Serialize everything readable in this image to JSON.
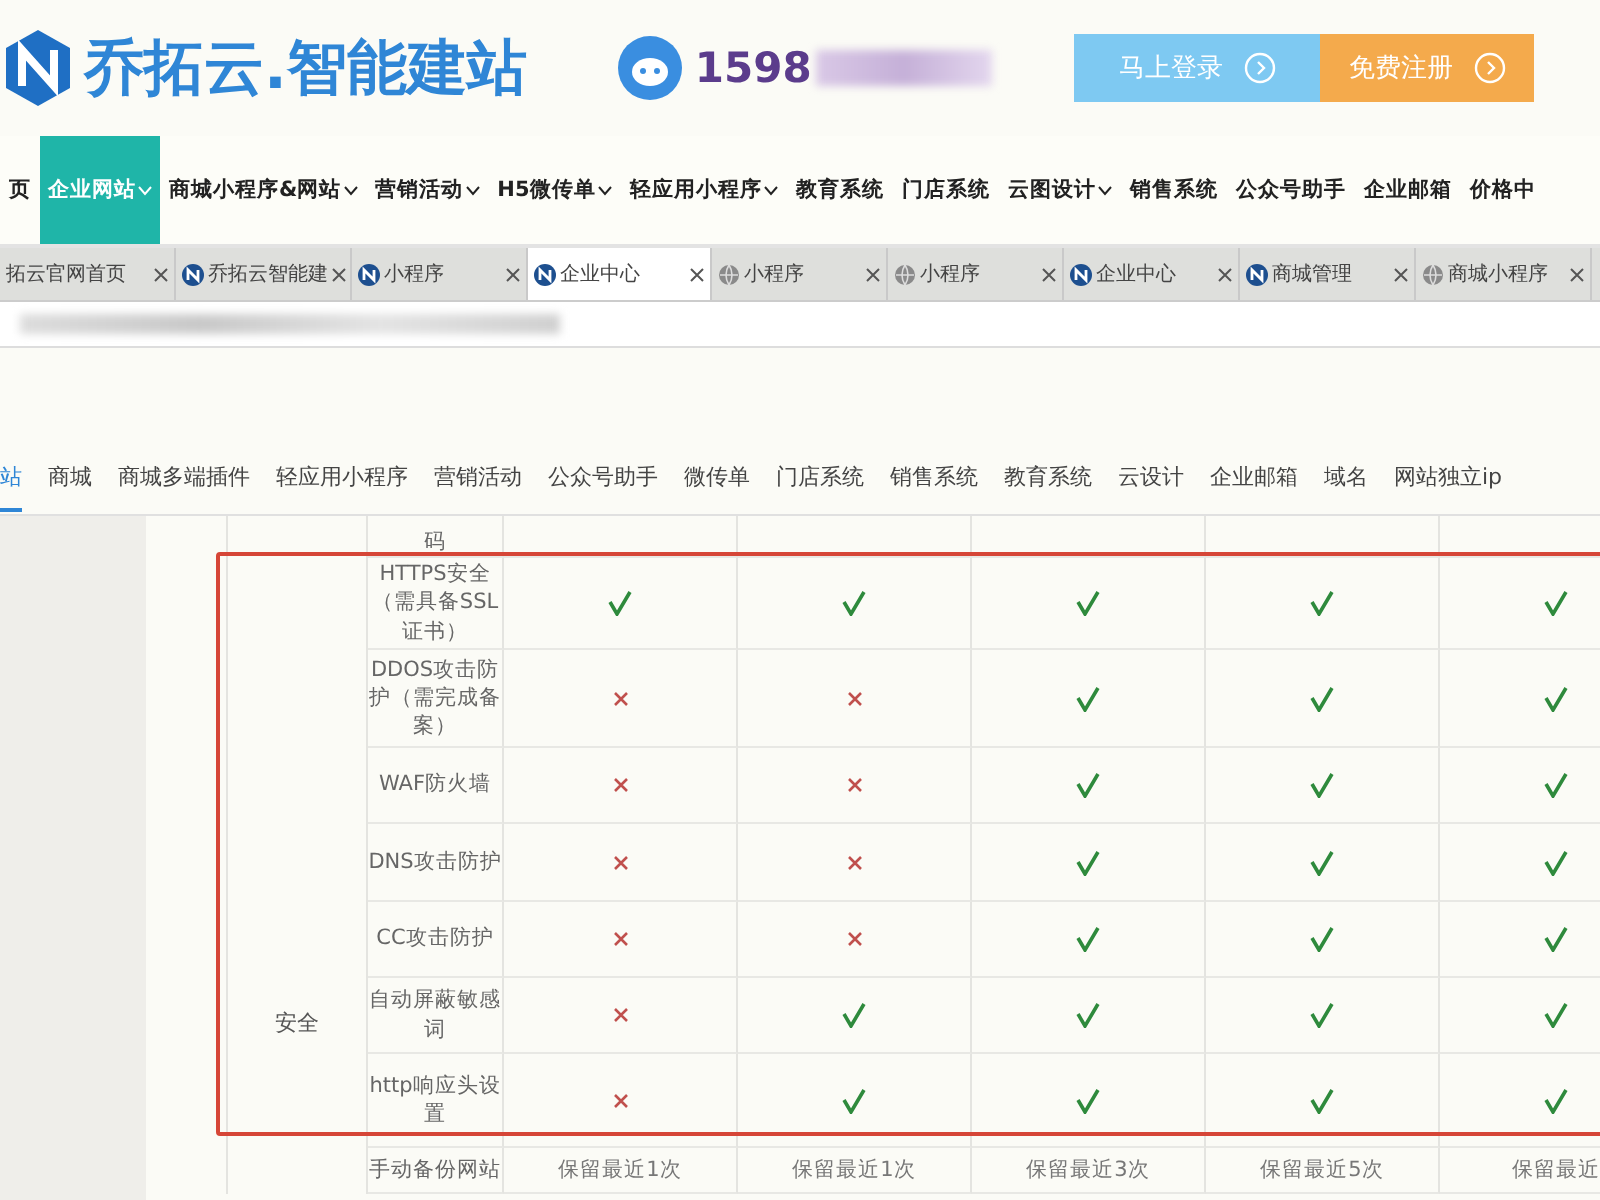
{
  "header": {
    "brand": "乔拓云.智能建站",
    "phone": "1598",
    "buttons": [
      {
        "label": "马上登录",
        "kind": "login"
      },
      {
        "label": "免费注册",
        "kind": "register"
      }
    ]
  },
  "nav": [
    {
      "label": "页",
      "selected": false,
      "dropdown": false
    },
    {
      "label": "企业网站",
      "selected": true,
      "dropdown": true
    },
    {
      "label": "商城小程序&网站",
      "selected": false,
      "dropdown": true
    },
    {
      "label": "营销活动",
      "selected": false,
      "dropdown": true
    },
    {
      "label": "H5微传单",
      "selected": false,
      "dropdown": true
    },
    {
      "label": "轻应用小程序",
      "selected": false,
      "dropdown": true
    },
    {
      "label": "教育系统",
      "selected": false,
      "dropdown": false
    },
    {
      "label": "门店系统",
      "selected": false,
      "dropdown": false
    },
    {
      "label": "云图设计",
      "selected": false,
      "dropdown": true
    },
    {
      "label": "销售系统",
      "selected": false,
      "dropdown": false
    },
    {
      "label": "公众号助手",
      "selected": false,
      "dropdown": false
    },
    {
      "label": "企业邮箱",
      "selected": false,
      "dropdown": false
    },
    {
      "label": "价格中",
      "selected": false,
      "dropdown": false
    }
  ],
  "browser_tabs": [
    {
      "title": "拓云官网首页",
      "kind": "plain",
      "selected": false
    },
    {
      "title": "乔拓云智能建",
      "kind": "site",
      "selected": false
    },
    {
      "title": "小程序",
      "kind": "site",
      "selected": false
    },
    {
      "title": "企业中心",
      "kind": "site",
      "selected": true
    },
    {
      "title": "小程序",
      "kind": "web",
      "selected": false
    },
    {
      "title": "小程序",
      "kind": "web",
      "selected": false
    },
    {
      "title": "企业中心",
      "kind": "site",
      "selected": false
    },
    {
      "title": "商城管理",
      "kind": "site",
      "selected": false
    },
    {
      "title": "商城小程序",
      "kind": "web",
      "selected": false
    }
  ],
  "sub_nav": [
    {
      "label": "站",
      "selected": true
    },
    {
      "label": "商城",
      "selected": false
    },
    {
      "label": "商城多端插件",
      "selected": false
    },
    {
      "label": "轻应用小程序",
      "selected": false
    },
    {
      "label": "营销活动",
      "selected": false
    },
    {
      "label": "公众号助手",
      "selected": false
    },
    {
      "label": "微传单",
      "selected": false
    },
    {
      "label": "门店系统",
      "selected": false
    },
    {
      "label": "销售系统",
      "selected": false
    },
    {
      "label": "教育系统",
      "selected": false
    },
    {
      "label": "云设计",
      "selected": false
    },
    {
      "label": "企业邮箱",
      "selected": false
    },
    {
      "label": "域名",
      "selected": false
    },
    {
      "label": "网站独立ip",
      "selected": false
    }
  ],
  "table": {
    "category": "安全",
    "rows": [
      {
        "kind": "partial",
        "feature": "码"
      },
      {
        "kind": "check",
        "feature": "HTTPS安全（需具备SSL证书）",
        "values": [
          true,
          true,
          true,
          true,
          true
        ]
      },
      {
        "kind": "check",
        "feature": "DDOS攻击防护（需完成备案）",
        "values": [
          false,
          false,
          true,
          true,
          true
        ]
      },
      {
        "kind": "check",
        "feature": "WAF防火墙",
        "values": [
          false,
          false,
          true,
          true,
          true
        ]
      },
      {
        "kind": "check",
        "feature": "DNS攻击防护",
        "values": [
          false,
          false,
          true,
          true,
          true
        ]
      },
      {
        "kind": "check",
        "feature": "CC攻击防护",
        "values": [
          false,
          false,
          true,
          true,
          true
        ]
      },
      {
        "kind": "check",
        "feature": "自动屏蔽敏感词",
        "values": [
          false,
          true,
          true,
          true,
          true
        ]
      },
      {
        "kind": "check",
        "feature": "http响应头设置",
        "values": [
          false,
          true,
          true,
          true,
          true
        ]
      },
      {
        "kind": "text",
        "feature": "手动备份网站",
        "texts": [
          "保留最近1次",
          "保留最近1次",
          "保留最近3次",
          "保留最近5次",
          "保留最近"
        ]
      }
    ]
  }
}
